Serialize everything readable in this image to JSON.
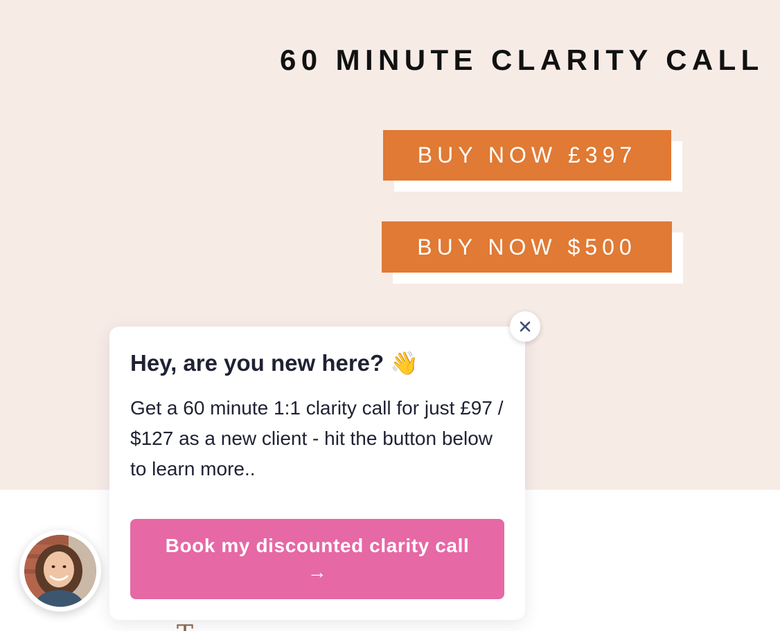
{
  "page": {
    "title": "60 MINUTE CLARITY CALL",
    "buy_button_gbp": "BUY NOW £397",
    "buy_button_usd": "BUY NOW $500",
    "below_fold_peek": "T"
  },
  "popup": {
    "title": "Hey, are you new here? 👋",
    "body": "Get a 60 minute 1:1 clarity call for just £97 / $127 as a new client - hit the button below to learn more..",
    "cta_label": "Book my discounted clarity call",
    "cta_arrow": "→",
    "close_icon": "close-icon",
    "avatar_icon": "avatar"
  },
  "colors": {
    "hero_background": "#f7ebe6",
    "button_orange": "#e07a34",
    "cta_pink": "#e668a5",
    "text_dark": "#1f2233"
  }
}
